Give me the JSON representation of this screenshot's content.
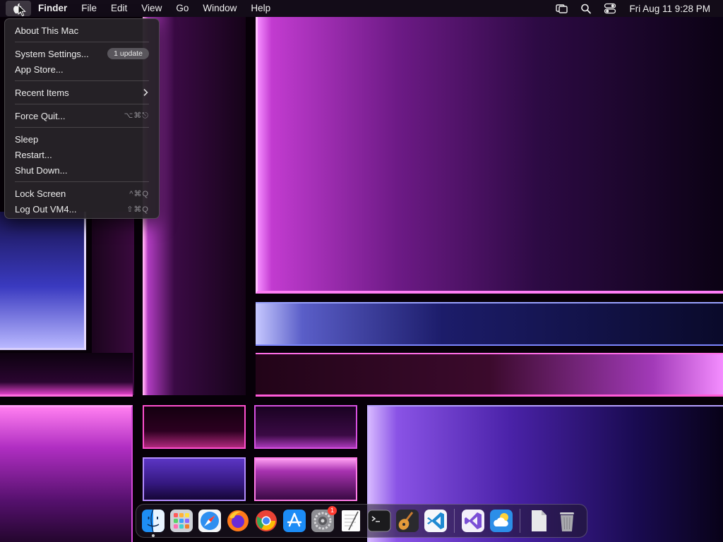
{
  "menubar": {
    "app_name": "Finder",
    "menus": [
      "File",
      "Edit",
      "View",
      "Go",
      "Window",
      "Help"
    ],
    "clock": "Fri Aug 11  9:28 PM",
    "status_icons": [
      "screen-mirroring-icon",
      "search-icon",
      "control-center-icon"
    ]
  },
  "apple_menu": {
    "about": "About This Mac",
    "system_settings": "System Settings...",
    "system_settings_badge": "1 update",
    "app_store": "App Store...",
    "recent_items": "Recent Items",
    "force_quit": "Force Quit...",
    "force_quit_shortcut": "⌥⌘⎋",
    "sleep": "Sleep",
    "restart": "Restart...",
    "shut_down": "Shut Down...",
    "lock_screen": "Lock Screen",
    "lock_screen_shortcut": "^⌘Q",
    "log_out": "Log Out VM4...",
    "log_out_shortcut": "⇧⌘Q"
  },
  "dock": {
    "apps": [
      "finder",
      "launchpad",
      "safari",
      "firefox",
      "chrome",
      "app-store",
      "system-settings",
      "textedit",
      "terminal",
      "garageband",
      "vscode",
      "visual-studio",
      "weather",
      "document",
      "trash"
    ],
    "system_settings_badge": "1"
  },
  "colors": {
    "menubar": "#160e1a",
    "menu_bg": "#262228",
    "badge": "#59565c",
    "notification": "#ff3b30"
  }
}
